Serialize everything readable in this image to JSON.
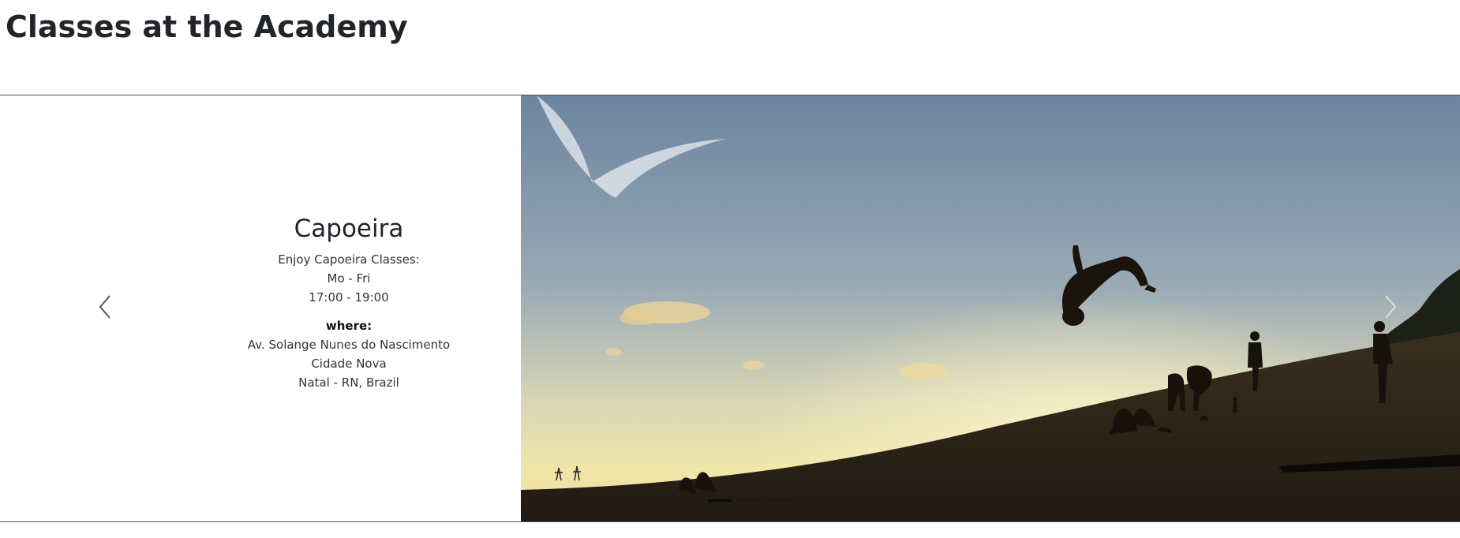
{
  "page": {
    "title": "Classes at the Academy"
  },
  "carousel": {
    "active_index": 0,
    "slides_count": 3,
    "slide": {
      "name": "Capoeira",
      "schedule_intro": "Enjoy Capoeira Classes:",
      "days": "Mo - Fri",
      "time": "17:00 - 19:00",
      "where_label": "where:",
      "address_line1": "Av. Solange Nunes do Nascimento",
      "address_line2": "Cidade Nova",
      "address_line3": "Natal - RN, Brazil"
    },
    "controls": {
      "prev_icon": "chevron-left-icon",
      "next_icon": "chevron-right-icon"
    },
    "image": {
      "alt": "Capoeira backflip silhouette on sand dune at sunset"
    }
  },
  "colors": {
    "sky_top": "#6e86a2",
    "sky_horizon": "#efe3a4",
    "sand": "#2c2418"
  }
}
